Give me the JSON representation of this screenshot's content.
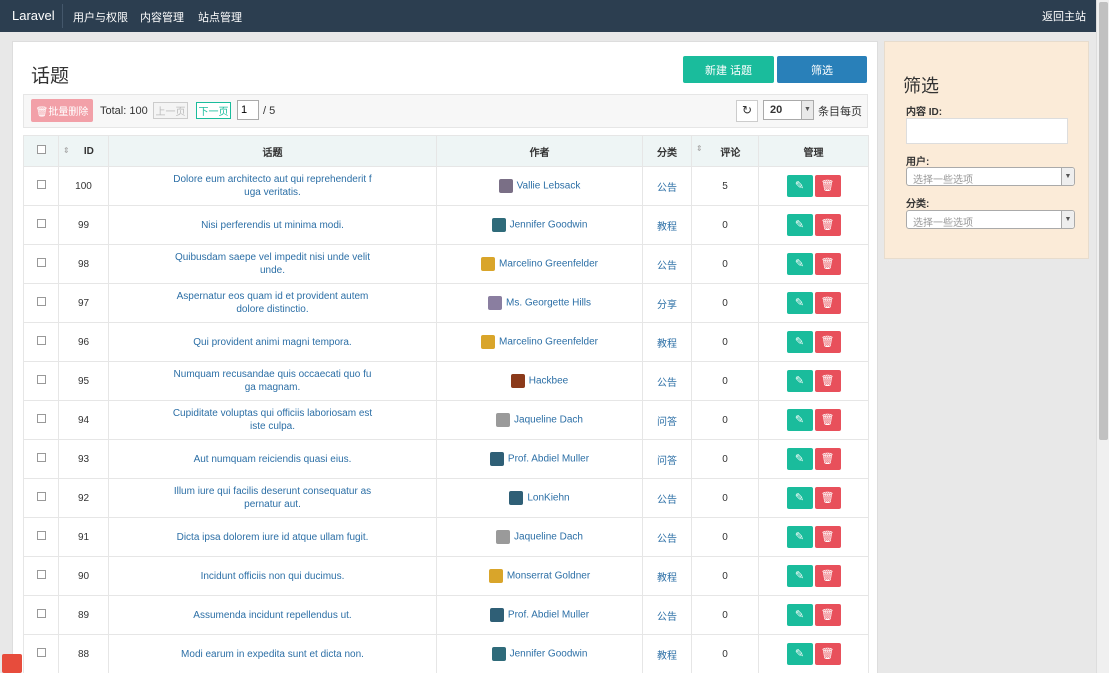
{
  "navbar": {
    "brand": "Laravel",
    "items": [
      "用户与权限",
      "内容管理",
      "站点管理"
    ],
    "back_home": "返回主站"
  },
  "main": {
    "title": "话题",
    "new_button": "新建 话题",
    "filter_button": "筛选",
    "batch_delete": "批量删除",
    "total": "Total: 100",
    "prev": "上一页",
    "next": "下一页",
    "page_value": "1",
    "page_total": "/ 5",
    "per_page_value": "20",
    "per_page_label": "条目每页"
  },
  "table": {
    "headers": {
      "id": "ID",
      "title": "话题",
      "author": "作者",
      "category": "分类",
      "comments": "评论",
      "manage": "管理"
    },
    "rows": [
      {
        "id": "100",
        "title": "Dolore eum architecto aut qui reprehenderit f uga veritatis.",
        "author": "Vallie Lebsack",
        "category": "公告",
        "comments": "5"
      },
      {
        "id": "99",
        "title": "Nisi perferendis ut minima modi.",
        "author": "Jennifer Goodwin",
        "category": "教程",
        "comments": "0"
      },
      {
        "id": "98",
        "title": "Quibusdam saepe vel impedit nisi unde velit unde.",
        "author": "Marcelino Greenfelder",
        "category": "公告",
        "comments": "0"
      },
      {
        "id": "97",
        "title": "Aspernatur eos quam id et provident autem dolore distinctio.",
        "author": "Ms. Georgette Hills",
        "category": "分享",
        "comments": "0"
      },
      {
        "id": "96",
        "title": "Qui provident animi magni tempora.",
        "author": "Marcelino Greenfelder",
        "category": "教程",
        "comments": "0"
      },
      {
        "id": "95",
        "title": "Numquam recusandae quis occaecati quo fu ga magnam.",
        "author": "Hackbee",
        "category": "公告",
        "comments": "0"
      },
      {
        "id": "94",
        "title": "Cupiditate voluptas qui officiis laboriosam est iste culpa.",
        "author": "Jaqueline Dach",
        "category": "问答",
        "comments": "0"
      },
      {
        "id": "93",
        "title": "Aut numquam reiciendis quasi eius.",
        "author": "Prof. Abdiel Muller",
        "category": "问答",
        "comments": "0"
      },
      {
        "id": "92",
        "title": "Illum iure qui facilis deserunt consequatur as pernatur aut.",
        "author": "LonKiehn",
        "category": "公告",
        "comments": "0"
      },
      {
        "id": "91",
        "title": "Dicta ipsa dolorem iure id atque ullam fugit.",
        "author": "Jaqueline Dach",
        "category": "公告",
        "comments": "0"
      },
      {
        "id": "90",
        "title": "Incidunt officiis non qui ducimus.",
        "author": "Monserrat Goldner",
        "category": "教程",
        "comments": "0"
      },
      {
        "id": "89",
        "title": "Assumenda incidunt repellendus ut.",
        "author": "Prof. Abdiel Muller",
        "category": "公告",
        "comments": "0"
      },
      {
        "id": "88",
        "title": "Modi earum in expedita sunt et dicta non.",
        "author": "Jennifer Goodwin",
        "category": "教程",
        "comments": "0"
      }
    ]
  },
  "filter": {
    "title": "筛选",
    "content_id_label": "内容 ID:",
    "user_label": "用户:",
    "user_placeholder": "选择一些选项",
    "category_label": "分类:",
    "category_placeholder": "选择一些选项"
  },
  "colors": {
    "navbar": "#2c3e50",
    "accent_green": "#1abc9c",
    "accent_blue": "#2980b9",
    "danger": "#e8505b",
    "link": "#2c6fa6",
    "filter_bg": "#fbebd8"
  },
  "icons": {
    "edit": "pencil-icon",
    "delete": "trash-icon",
    "refresh": "refresh-icon"
  }
}
